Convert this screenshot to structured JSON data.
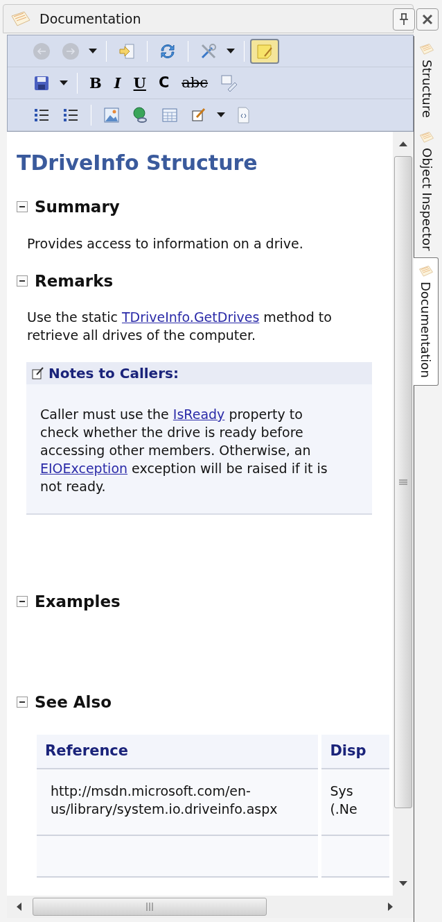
{
  "panel": {
    "title": "Documentation"
  },
  "toolbars": [
    [
      {
        "kind": "back",
        "disabled": true,
        "pressed": false
      },
      {
        "kind": "forward",
        "disabled": true,
        "pressed": false
      },
      {
        "kind": "dropdown",
        "disabled": false,
        "pressed": false
      },
      {
        "kind": "separator"
      },
      {
        "kind": "import",
        "disabled": false,
        "pressed": false
      },
      {
        "kind": "separator"
      },
      {
        "kind": "refresh",
        "disabled": false,
        "pressed": false
      },
      {
        "kind": "separator"
      },
      {
        "kind": "tools",
        "disabled": false,
        "pressed": false
      },
      {
        "kind": "dropdown",
        "disabled": false,
        "pressed": false
      },
      {
        "kind": "separator"
      },
      {
        "kind": "note",
        "disabled": false,
        "pressed": true
      }
    ],
    [
      {
        "kind": "save",
        "disabled": false,
        "pressed": false
      },
      {
        "kind": "dropdown",
        "disabled": false,
        "pressed": false
      },
      {
        "kind": "separator"
      },
      {
        "kind": "bold",
        "label": "B",
        "disabled": false,
        "pressed": false
      },
      {
        "kind": "italic",
        "label": "I",
        "disabled": false,
        "pressed": false
      },
      {
        "kind": "underline",
        "label": "U",
        "disabled": false,
        "pressed": false
      },
      {
        "kind": "code",
        "label": "C",
        "disabled": false,
        "pressed": false
      },
      {
        "kind": "strike",
        "label": "abc",
        "disabled": false,
        "pressed": false
      },
      {
        "kind": "spell",
        "disabled": false,
        "pressed": false
      }
    ],
    [
      {
        "kind": "bullets",
        "disabled": false,
        "pressed": false
      },
      {
        "kind": "numbers",
        "disabled": false,
        "pressed": false
      },
      {
        "kind": "separator"
      },
      {
        "kind": "image",
        "disabled": false,
        "pressed": false
      },
      {
        "kind": "link",
        "disabled": false,
        "pressed": false
      },
      {
        "kind": "table",
        "disabled": false,
        "pressed": false
      },
      {
        "kind": "edit",
        "disabled": false,
        "pressed": false
      },
      {
        "kind": "dropdown",
        "disabled": false,
        "pressed": false
      },
      {
        "kind": "source",
        "disabled": false,
        "pressed": false
      }
    ]
  ],
  "document": {
    "title": "TDriveInfo Structure",
    "sections": [
      {
        "heading": "Summary",
        "expanded": true,
        "blocks": [
          {
            "kind": "paragraph",
            "parts": [
              {
                "text": "Provides access to information on a drive."
              }
            ]
          }
        ]
      },
      {
        "heading": "Remarks",
        "expanded": true,
        "blocks": [
          {
            "kind": "paragraph",
            "parts": [
              {
                "text": "Use the static "
              },
              {
                "link": "TDriveInfo.GetDrives"
              },
              {
                "text": " method to retrieve all drives of the computer."
              }
            ]
          },
          {
            "kind": "note",
            "title": "Notes to Callers:",
            "parts": [
              {
                "text": "Caller must use the "
              },
              {
                "link": "IsReady"
              },
              {
                "text": " property to check whether the drive is ready before accessing other members. Otherwise, an "
              },
              {
                "link": "EIOException"
              },
              {
                "text": " exception will be raised if it is not ready."
              }
            ]
          }
        ]
      },
      {
        "heading": "Examples",
        "expanded": true
      },
      {
        "heading": "See Also",
        "expanded": true,
        "blocks": [
          {
            "kind": "table",
            "columns": [
              "Reference",
              "Disp"
            ],
            "rows": [
              [
                "http://msdn.microsoft.com/en-us/library/system.io.driveinfo.aspx",
                "Sys (.Ne"
              ],
              []
            ]
          }
        ]
      }
    ]
  },
  "side_tabs": [
    {
      "label": "Structure",
      "selected": false
    },
    {
      "label": "Object Inspector",
      "selected": false
    },
    {
      "label": "Documentation",
      "selected": true
    }
  ]
}
